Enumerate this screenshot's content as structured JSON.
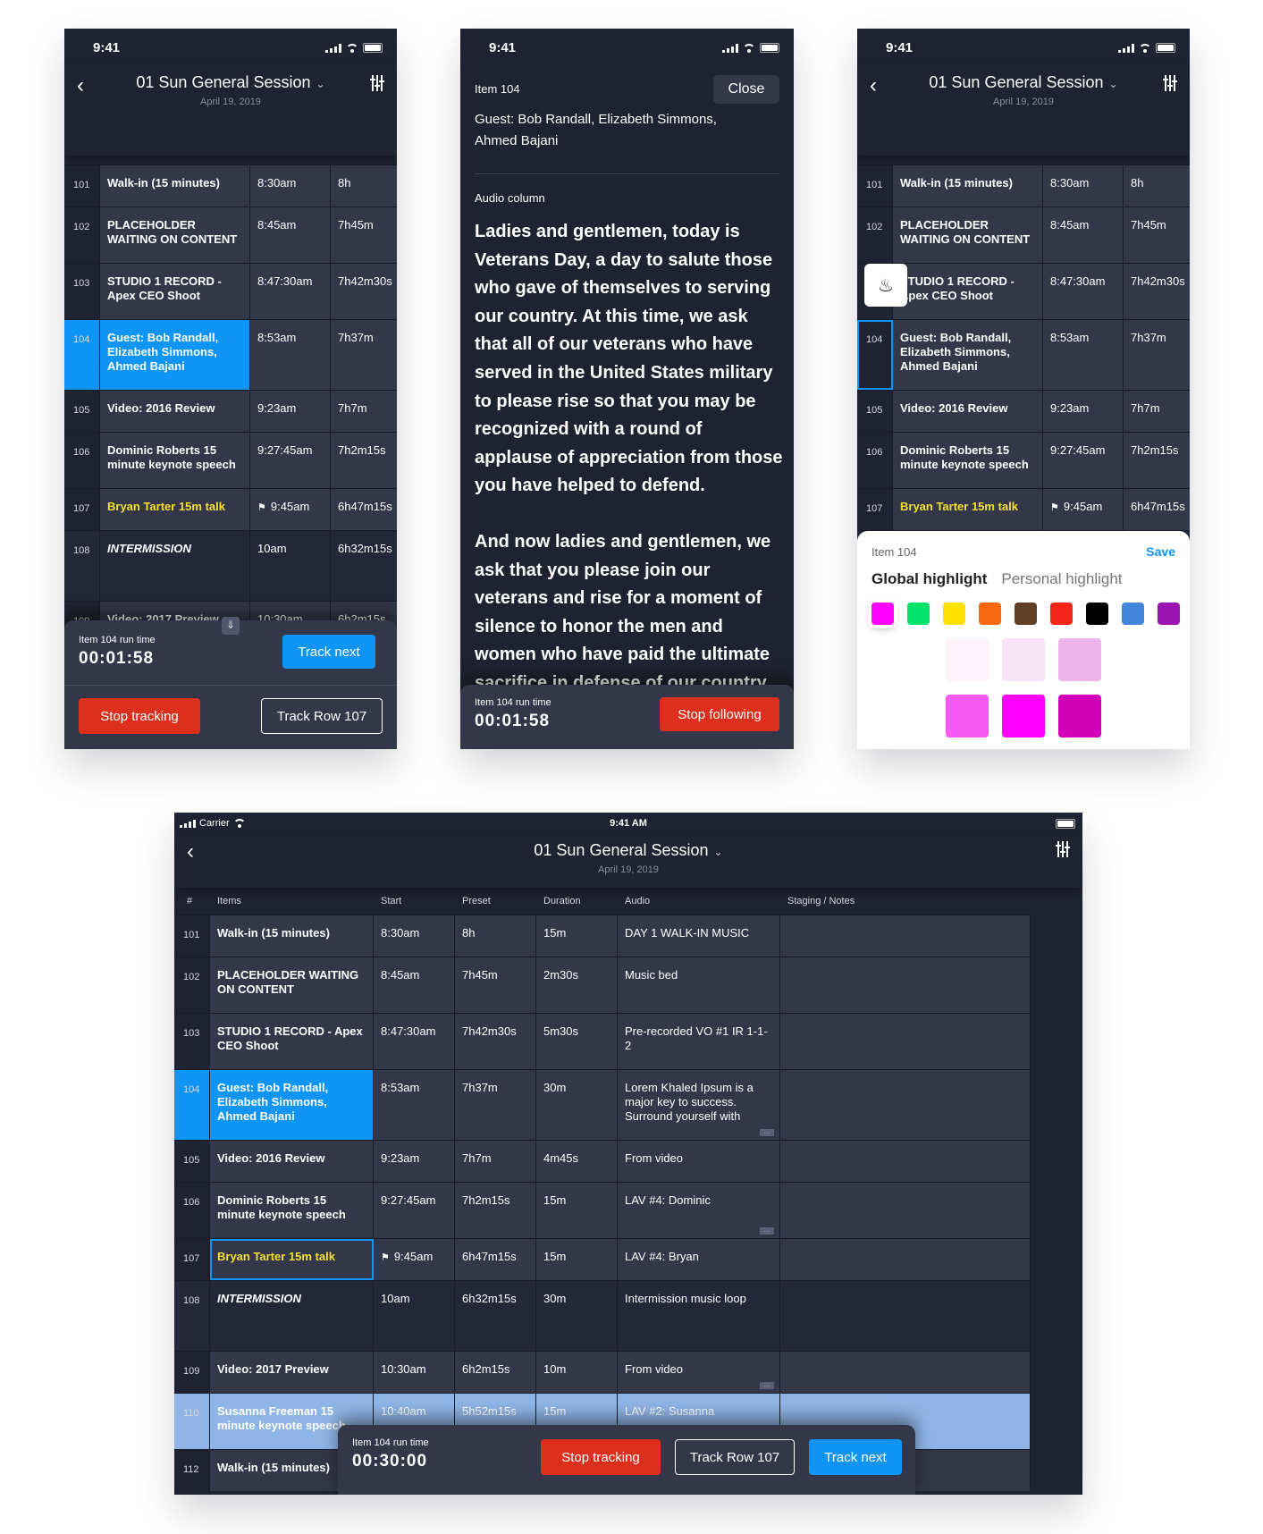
{
  "status": {
    "time": "9:41",
    "tablet_time": "9:41 AM",
    "carrier": "Carrier"
  },
  "header": {
    "title": "01 Sun General Session",
    "date": "April 19, 2019"
  },
  "columns": {
    "num": "#",
    "items": "Items",
    "start": "Start",
    "preset": "Preset",
    "duration": "Duration",
    "audio": "Audio",
    "notes": "Staging / Notes"
  },
  "rows": [
    {
      "num": "101",
      "item": "Walk-in (15 minutes)",
      "start": "8:30am",
      "preset": "8h",
      "duration": "15m",
      "audio": "DAY 1 WALK-IN MUSIC"
    },
    {
      "num": "102",
      "item": "PLACEHOLDER WAITING ON CONTENT",
      "start": "8:45am",
      "preset": "7h45m",
      "duration": "2m30s",
      "audio": "Music bed"
    },
    {
      "num": "103",
      "item": "STUDIO 1 RECORD - Apex CEO Shoot",
      "start": "8:47:30am",
      "preset": "7h42m30s",
      "duration": "5m30s",
      "audio": "Pre-recorded VO #1 IR 1-1-2"
    },
    {
      "num": "104",
      "item": "Guest:  Bob Randall, Elizabeth Simmons, Ahmed Bajani",
      "start": "8:53am",
      "preset": "7h37m",
      "duration": "30m",
      "audio": "Lorem Khaled Ipsum is a major key to success. Surround yourself with"
    },
    {
      "num": "105",
      "item": "Video:  2016 Review",
      "start": "9:23am",
      "preset": "7h7m",
      "duration": "4m45s",
      "audio": "From video"
    },
    {
      "num": "106",
      "item": "Dominic Roberts 15 minute keynote speech",
      "start": "9:27:45am",
      "preset": "7h2m15s",
      "duration": "15m",
      "audio": "LAV #4: Dominic"
    },
    {
      "num": "107",
      "item": "Bryan Tarter 15m talk",
      "start": "9:45am",
      "preset": "6h47m15s",
      "duration": "15m",
      "audio": "LAV #4: Bryan"
    },
    {
      "num": "108",
      "item": "INTERMISSION",
      "start": "10am",
      "preset": "6h32m15s",
      "duration": "30m",
      "audio": "Intermission music loop"
    },
    {
      "num": "109",
      "item": "Video:  2017 Preview",
      "start": "10:30am",
      "preset": "6h2m15s",
      "duration": "10m",
      "audio": "From video"
    },
    {
      "num": "110",
      "item": "Susanna Freeman 15 minute keynote speech",
      "start": "10:40am",
      "preset": "5h52m15s",
      "duration": "15m",
      "audio": "LAV #2: Susanna"
    },
    {
      "num": "112",
      "item": "Walk-in (15 minutes)",
      "start": "",
      "preset": "",
      "duration": "",
      "audio": ""
    }
  ],
  "tracking": {
    "run_label": "Item 104 run time",
    "run_time_phone": "00:01:58",
    "run_time_tablet": "00:30:00",
    "track_next": "Track next",
    "stop_tracking": "Stop tracking",
    "track_row": "Track Row 107",
    "stop_following": "Stop following"
  },
  "detail": {
    "item_label": "Item 104",
    "close": "Close",
    "guest": "Guest:  Bob Randall, Elizabeth Simmons, Ahmed Bajani",
    "column_label": "Audio column",
    "paragraph1": "Ladies and gentlemen, today is Veterans Day, a day to salute those who gave of themselves to serving our country.  At this time, we ask that all of our veterans who have served in the United States military to please rise so that you may be recognized with a round of applause of appreciation from those you have helped to defend.",
    "paragraph2": "And now ladies and gentlemen, we ask that you please join our veterans and rise for a moment of silence to honor the men and women who have paid the ultimate sacrifice in defense of our country."
  },
  "highlight": {
    "item_label": "Item 104",
    "save": "Save",
    "tab_global": "Global highlight",
    "tab_personal": "Personal highlight",
    "colors": [
      "#ff00ff",
      "#00e36b",
      "#ffe100",
      "#f8680f",
      "#5f3f26",
      "#f32517",
      "#000000",
      "#4286db",
      "#9c13b4"
    ],
    "selected_color": "#ff00ff",
    "shades": [
      "#fcf2fb",
      "#f8e2f6",
      "#efb3ec",
      "#f75af2",
      "#ff00ff",
      "#d200b8"
    ]
  },
  "colors": {
    "accent": "#0f95f7",
    "danger": "#de2f1d",
    "highlight_yellow": "#f4e02c",
    "tracked_row": "#8fb5e6"
  }
}
